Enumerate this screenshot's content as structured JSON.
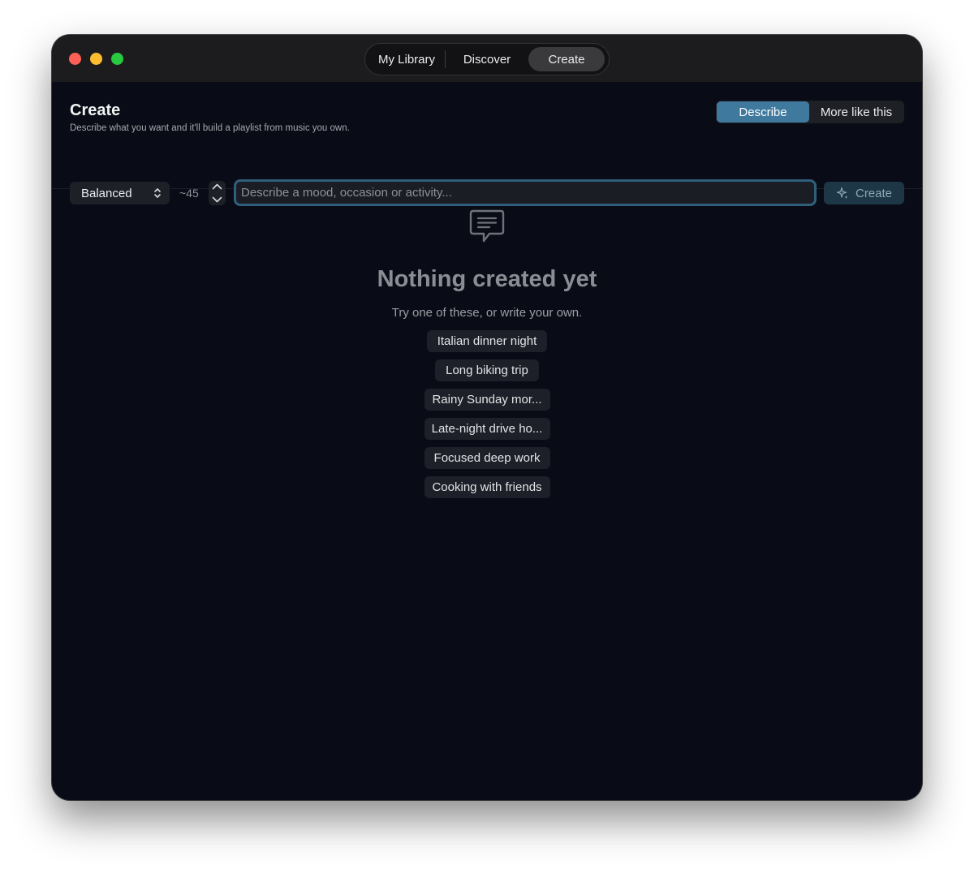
{
  "nav": {
    "tabs": [
      {
        "label": "My Library"
      },
      {
        "label": "Discover"
      },
      {
        "label": "Create",
        "active": true
      }
    ]
  },
  "header": {
    "title": "Create",
    "subtitle": "Describe what you want and it'll build a playlist from music you own."
  },
  "mode": {
    "options": [
      "Describe",
      "More like this"
    ],
    "selected": "Describe"
  },
  "controls": {
    "style_select": "Balanced",
    "count": "~45",
    "prompt_value": "",
    "prompt_placeholder": "Describe a mood, occasion or activity...",
    "create_label": "Create"
  },
  "empty_state": {
    "icon": "chat-bubble-icon",
    "title": "Nothing created yet",
    "subtitle": "Try one of these, or write your own.",
    "suggestions": [
      "Italian dinner night",
      "Long biking trip",
      "Rainy Sunday mor...",
      "Late-night drive ho...",
      "Focused deep work",
      "Cooking with friends"
    ]
  },
  "colors": {
    "background": "#090c16",
    "titlebar": "#1c1c1e",
    "accent": "#3f7a9e",
    "input_focus": "#2f5f7c"
  }
}
